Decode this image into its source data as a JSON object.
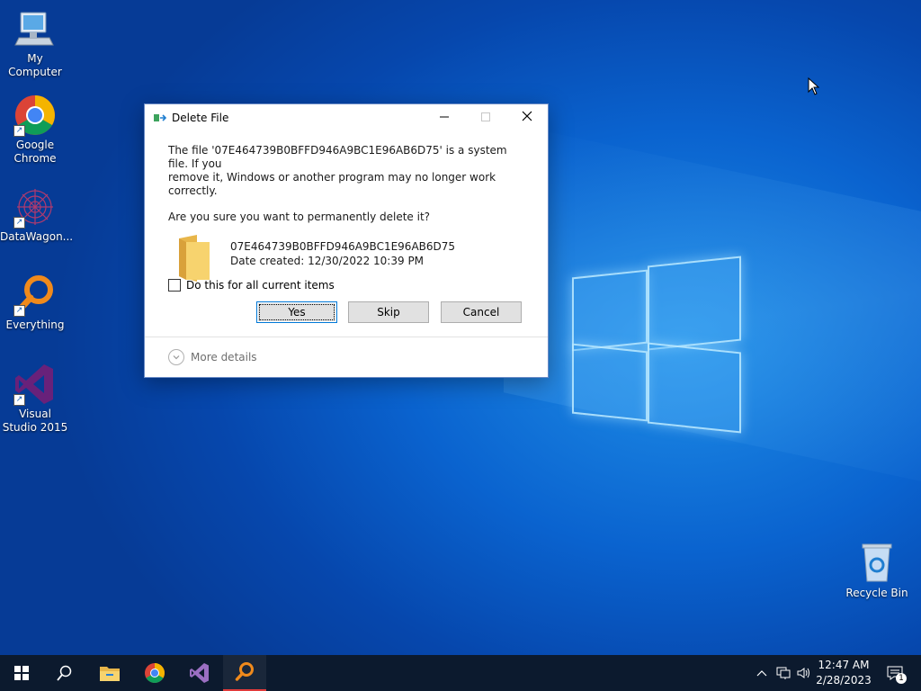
{
  "desktop": {
    "icons": [
      {
        "label": "My Computer",
        "icon": "computer-icon"
      },
      {
        "label": "Google Chrome",
        "icon": "chrome-icon"
      },
      {
        "label": "DataWagon...",
        "icon": "datawagon-icon"
      },
      {
        "label": "Everything",
        "icon": "everything-search-icon"
      },
      {
        "label": "Visual Studio 2015",
        "icon": "visual-studio-icon"
      },
      {
        "label": "Recycle Bin",
        "icon": "recycle-bin-icon"
      }
    ]
  },
  "dialog": {
    "title": "Delete File",
    "message_line1": "The file '07E464739B0BFFD946A9BC1E96AB6D75' is a system file. If you",
    "message_line2": "remove it, Windows or another program may no longer work correctly.",
    "question": "Are you sure you want to permanently delete it?",
    "file_name": "07E464739B0BFFD946A9BC1E96AB6D75",
    "date_created": "Date created: 12/30/2022 10:39 PM",
    "checkbox_label": "Do this for all current items",
    "checkbox_checked": false,
    "buttons": {
      "yes": "Yes",
      "skip": "Skip",
      "cancel": "Cancel"
    },
    "more_details": "More details"
  },
  "taskbar": {
    "pinned": [
      "start-icon",
      "search-icon",
      "file-explorer-icon",
      "chrome-icon",
      "visual-studio-icon",
      "everything-search-icon"
    ],
    "clock": {
      "time": "12:47 AM",
      "date": "2/28/2023"
    },
    "notification_count": "1"
  },
  "colors": {
    "desktop_blue": "#0a63cf",
    "taskbar": "#0c1a2e",
    "active_indicator": "#e03a3a",
    "accent": "#0078d7"
  }
}
